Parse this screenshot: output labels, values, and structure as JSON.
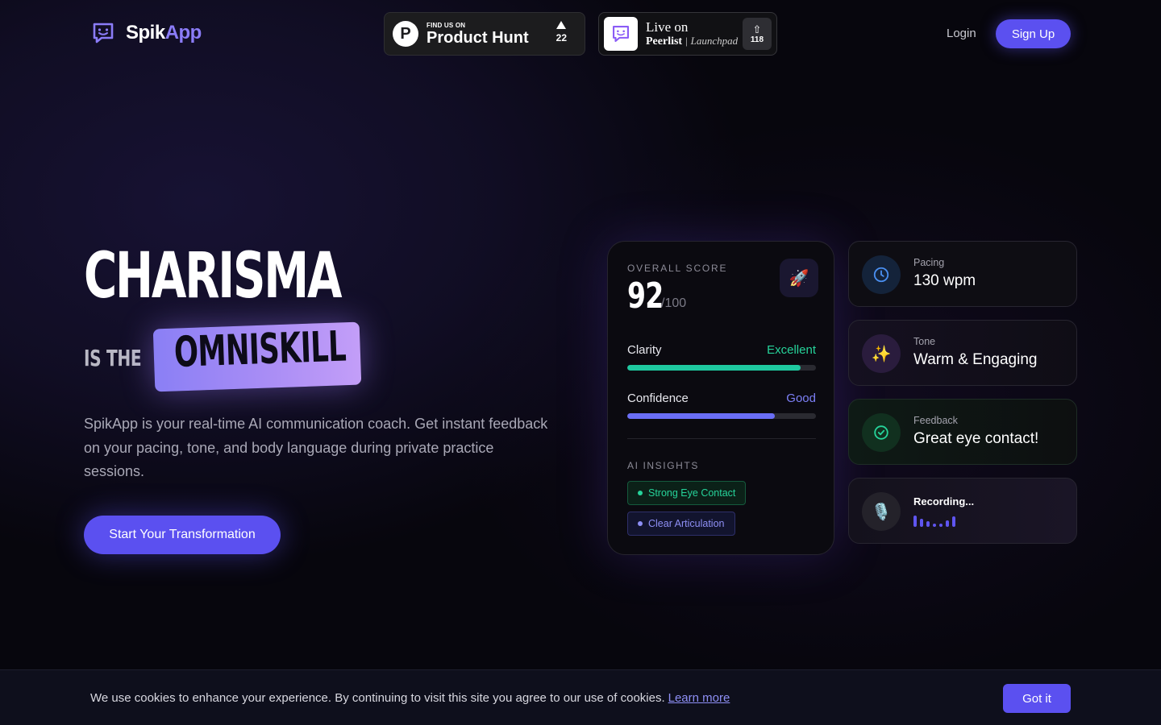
{
  "header": {
    "logo_part1": "Spik",
    "logo_part2": "App",
    "product_hunt": {
      "small": "FIND US ON",
      "big": "Product Hunt",
      "votes": "22"
    },
    "peerlist": {
      "live": "Live on",
      "name": "Peerlist",
      "launchpad": "Launchpad",
      "votes": "118"
    },
    "login": "Login",
    "signup": "Sign Up"
  },
  "hero": {
    "title": "CHARISMA",
    "is_the": "IS THE",
    "highlight": "OMNISKILL",
    "description": "SpikApp is your real-time AI communication coach. Get instant feedback on your pacing, tone, and body language during private practice sessions.",
    "cta": "Start Your Transformation"
  },
  "score_card": {
    "label": "OVERALL SCORE",
    "score": "92",
    "max": "/100",
    "metrics": [
      {
        "name": "Clarity",
        "rating": "Excellent",
        "fill": 0.92,
        "color": "#1fc9a0",
        "rating_color": "#26d39a"
      },
      {
        "name": "Confidence",
        "rating": "Good",
        "fill": 0.78,
        "color": "#6a6ef5",
        "rating_color": "#7d80f7"
      }
    ],
    "insights_label": "AI INSIGHTS",
    "tags": [
      "Strong Eye Contact",
      "Clear Articulation"
    ]
  },
  "side_cards": {
    "pacing": {
      "label": "Pacing",
      "value": "130 wpm"
    },
    "tone": {
      "label": "Tone",
      "value": "Warm & Engaging"
    },
    "feedback": {
      "label": "Feedback",
      "value": "Great eye contact!"
    },
    "recording": {
      "label": "Recording..."
    }
  },
  "cookie": {
    "text": "We use cookies to enhance your experience. By continuing to visit this site you agree to our use of cookies.",
    "link": "Learn more",
    "button": "Got it"
  },
  "colors": {
    "accent": "#5b50f0",
    "green": "#26d39a",
    "purple": "#8b7cf8"
  },
  "icons": [
    "chat-bubble-icon",
    "product-hunt-icon",
    "upvote-icon",
    "rocket-icon",
    "clock-icon",
    "sparkles-icon",
    "check-circle-icon",
    "microphone-icon"
  ]
}
